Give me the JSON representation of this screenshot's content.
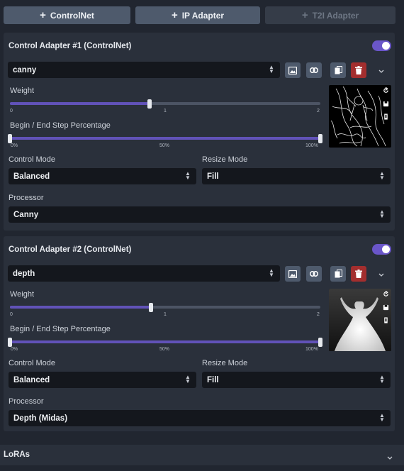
{
  "add_buttons": {
    "controlnet": "ControlNet",
    "ip_adapter": "IP Adapter",
    "t2i_adapter": "T2I Adapter"
  },
  "adapters": [
    {
      "title": "Control Adapter #1 (ControlNet)",
      "enabled": true,
      "model": "canny",
      "weight_label": "Weight",
      "weight": 0.9,
      "weight_ticks": [
        "0",
        "1",
        "2"
      ],
      "step_label": "Begin / End Step Percentage",
      "step_range": [
        0,
        100
      ],
      "step_ticks": [
        "0%",
        "50%",
        "100%"
      ],
      "control_mode_label": "Control Mode",
      "control_mode": "Balanced",
      "resize_mode_label": "Resize Mode",
      "resize_mode": "Fill",
      "processor_label": "Processor",
      "processor": "Canny"
    },
    {
      "title": "Control Adapter #2 (ControlNet)",
      "enabled": true,
      "model": "depth",
      "weight_label": "Weight",
      "weight": 0.91,
      "weight_ticks": [
        "0",
        "1",
        "2"
      ],
      "step_label": "Begin / End Step Percentage",
      "step_range": [
        0,
        100
      ],
      "step_ticks": [
        "0%",
        "50%",
        "100%"
      ],
      "control_mode_label": "Control Mode",
      "control_mode": "Balanced",
      "resize_mode_label": "Resize Mode",
      "resize_mode": "Fill",
      "processor_label": "Processor",
      "processor": "Depth (Midas)"
    }
  ],
  "loras": {
    "label": "LoRAs"
  },
  "colors": {
    "accent": "#6a56c9",
    "slider_fill": "#6152b8",
    "delete": "#a32e2e",
    "button": "#4e5a6c"
  },
  "icons": [
    "plus-icon",
    "image-icon",
    "link-icon",
    "copy-icon",
    "trash-icon",
    "chevron-down-icon",
    "reset-icon",
    "save-icon",
    "edit-icon"
  ]
}
